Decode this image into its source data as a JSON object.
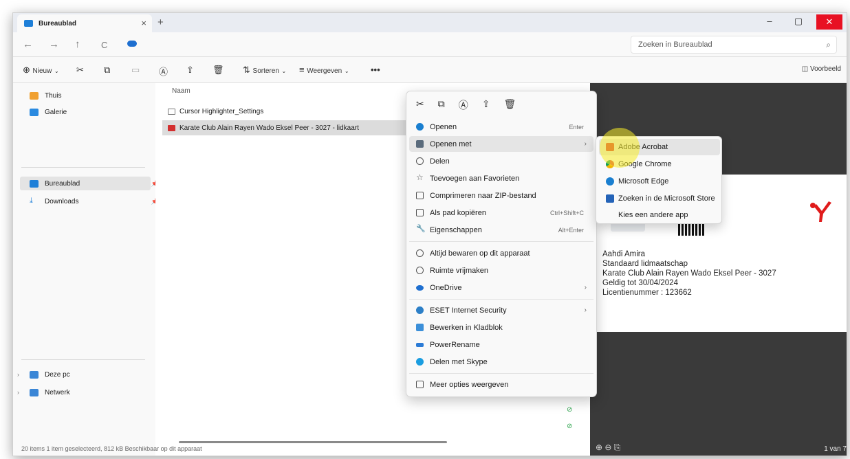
{
  "tab": {
    "title": "Bureaublad",
    "close": "×",
    "new": "+"
  },
  "window_controls": {
    "minimize": "–",
    "maximize": "▢",
    "close": "✕"
  },
  "nav": {
    "back": "←",
    "forward": "→",
    "up": "↑",
    "refresh": "C",
    "search_placeholder": "Zoeken in Bureaublad"
  },
  "toolbar": {
    "new_label": "Nieuw",
    "sort_label": "Sorteren",
    "view_label": "Weergeven",
    "more": "•••",
    "preview_label": "Voorbeeld"
  },
  "sidebar": {
    "quick": [
      {
        "label": "Thuis"
      },
      {
        "label": "Galerie"
      }
    ],
    "pinned": [
      {
        "label": "Bureaublad"
      },
      {
        "label": "Downloads"
      }
    ],
    "tree": [
      {
        "label": "Deze pc"
      },
      {
        "label": "Netwerk"
      }
    ]
  },
  "list": {
    "column_name": "Naam",
    "files": [
      {
        "name": "Cursor Highlighter_Settings"
      },
      {
        "name": "Karate Club Alain Rayen Wado Eksel Peer - 3027 - lidkaart"
      }
    ],
    "status_text": "20 items    1 item geselecteerd, 812 kB    Beschikbaar op dit apparaat"
  },
  "context_menu": {
    "items": [
      {
        "label": "Openen",
        "shortcut": "Enter"
      },
      {
        "label": "Openen met",
        "arrow": "›"
      },
      {
        "label": "Delen"
      },
      {
        "label": "Toevoegen aan Favorieten"
      },
      {
        "label": "Comprimeren naar ZIP-bestand"
      },
      {
        "label": "Als pad kopiëren",
        "shortcut": "Ctrl+Shift+C"
      },
      {
        "label": "Eigenschappen",
        "shortcut": "Alt+Enter"
      },
      {
        "label": "Altijd bewaren op dit apparaat"
      },
      {
        "label": "Ruimte vrijmaken"
      },
      {
        "label": "OneDrive",
        "arrow": "›"
      },
      {
        "label": "ESET Internet Security",
        "arrow": "›"
      },
      {
        "label": "Bewerken in Kladblok"
      },
      {
        "label": "PowerRename"
      },
      {
        "label": "Delen met Skype"
      },
      {
        "label": "Meer opties weergeven"
      }
    ]
  },
  "submenu": {
    "items": [
      {
        "label": "Adobe Acrobat"
      },
      {
        "label": "Google Chrome"
      },
      {
        "label": "Microsoft Edge"
      },
      {
        "label": "Zoeken in de Microsoft Store"
      },
      {
        "label": "Kies een andere app"
      }
    ]
  },
  "preview": {
    "lines": [
      "Aahdi Amira",
      "Standaard lidmaatschap",
      "Karate Club Alain Rayen Wado Eksel Peer - 3027",
      "Geldig tot 30/04/2024",
      "Licentienummer : 123662"
    ],
    "page": "1 van 7"
  },
  "colors": {
    "accent": "#1e7fd8",
    "close": "#e81123",
    "pdf": "#d32f2f",
    "highlight": "#f8ec28"
  }
}
